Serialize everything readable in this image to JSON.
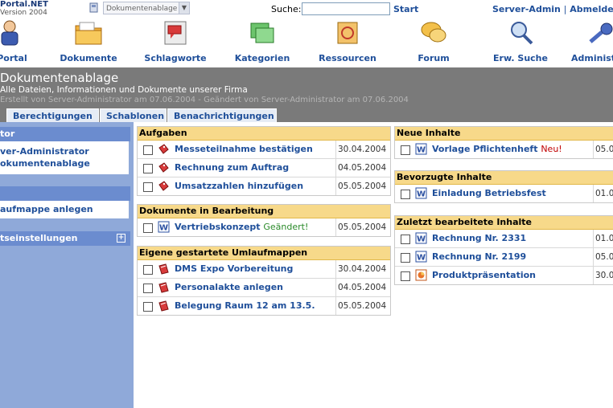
{
  "brand": {
    "name": "Portal.NET",
    "version": "Version 2004"
  },
  "top": {
    "selector_value": "Dokumentenablage",
    "search_label": "Suche:",
    "search_value": "",
    "start_label": "Start",
    "server_admin": "Server-Admin",
    "separator": "|",
    "logout": "Abmelden"
  },
  "nav": [
    {
      "label": "Portal",
      "icon": "person-icon"
    },
    {
      "label": "Dokumente",
      "icon": "folder-icon"
    },
    {
      "label": "Schlagworte",
      "icon": "tags-icon"
    },
    {
      "label": "Kategorien",
      "icon": "categories-icon"
    },
    {
      "label": "Ressourcen",
      "icon": "resources-icon"
    },
    {
      "label": "Forum",
      "icon": "forum-icon"
    },
    {
      "label": "Erw. Suche",
      "icon": "magnifier-icon"
    },
    {
      "label": "Administ",
      "icon": "key-icon"
    }
  ],
  "header": {
    "title": "Dokumentenablage",
    "description": "Alle Dateien, Informationen und Dokumente unserer Firma",
    "meta": "Erstellt von Server-Administrator am 07.06.2004 - Geändert von Server-Administrator am 07.06.2004",
    "tabs": [
      "Berechtigungen",
      "Schablonen",
      "Benachrichtigungen"
    ]
  },
  "sidebar": {
    "section1_title": "tor",
    "section1_items": [
      "ver-Administrator",
      "okumentenablage"
    ],
    "section2_title": "",
    "section2_items": [
      "aufmappe anlegen"
    ],
    "section3_title": "tseinstellungen",
    "plus": "+"
  },
  "aufgaben": {
    "title": "Aufgaben",
    "rows": [
      {
        "label": "Messeteilnahme bestätigen",
        "date": "30.04.2004"
      },
      {
        "label": "Rechnung zum Auftrag",
        "date": "04.05.2004"
      },
      {
        "label": "Umsatzzahlen hinzufügen",
        "date": "05.05.2004"
      }
    ]
  },
  "bearbeitung": {
    "title": "Dokumente in Bearbeitung",
    "rows": [
      {
        "label": "Vertriebskonzept",
        "status": "Geändert!",
        "date": "05.05.2004"
      }
    ]
  },
  "umlaufmappen": {
    "title": "Eigene gestartete Umlaufmappen",
    "rows": [
      {
        "label": "DMS Expo Vorbereitung",
        "date": "30.04.2004"
      },
      {
        "label": "Personalakte anlegen",
        "date": "04.05.2004"
      },
      {
        "label": "Belegung Raum 12 am 13.5.",
        "date": "05.05.2004"
      }
    ]
  },
  "neue": {
    "title": "Neue Inhalte",
    "rows": [
      {
        "label": "Vorlage Pflichtenheft",
        "badge": "Neu!",
        "date": "05.0"
      }
    ]
  },
  "bevorzugt": {
    "title": "Bevorzugte Inhalte",
    "rows": [
      {
        "label": "Einladung Betriebsfest",
        "date": "01.0"
      }
    ]
  },
  "zuletzt": {
    "title": "Zuletzt bearbeitete Inhalte",
    "rows": [
      {
        "label": "Rechnung Nr. 2331",
        "date": "01.0"
      },
      {
        "label": "Rechnung Nr. 2199",
        "date": "05.0"
      },
      {
        "label": "Produktpräsentation",
        "date": "30.0"
      }
    ]
  },
  "colors": {
    "link": "#1f4f9a",
    "panel_header": "#f7d98a",
    "sidebar": "#8fa9d9",
    "header_band": "#7a7a7a"
  }
}
